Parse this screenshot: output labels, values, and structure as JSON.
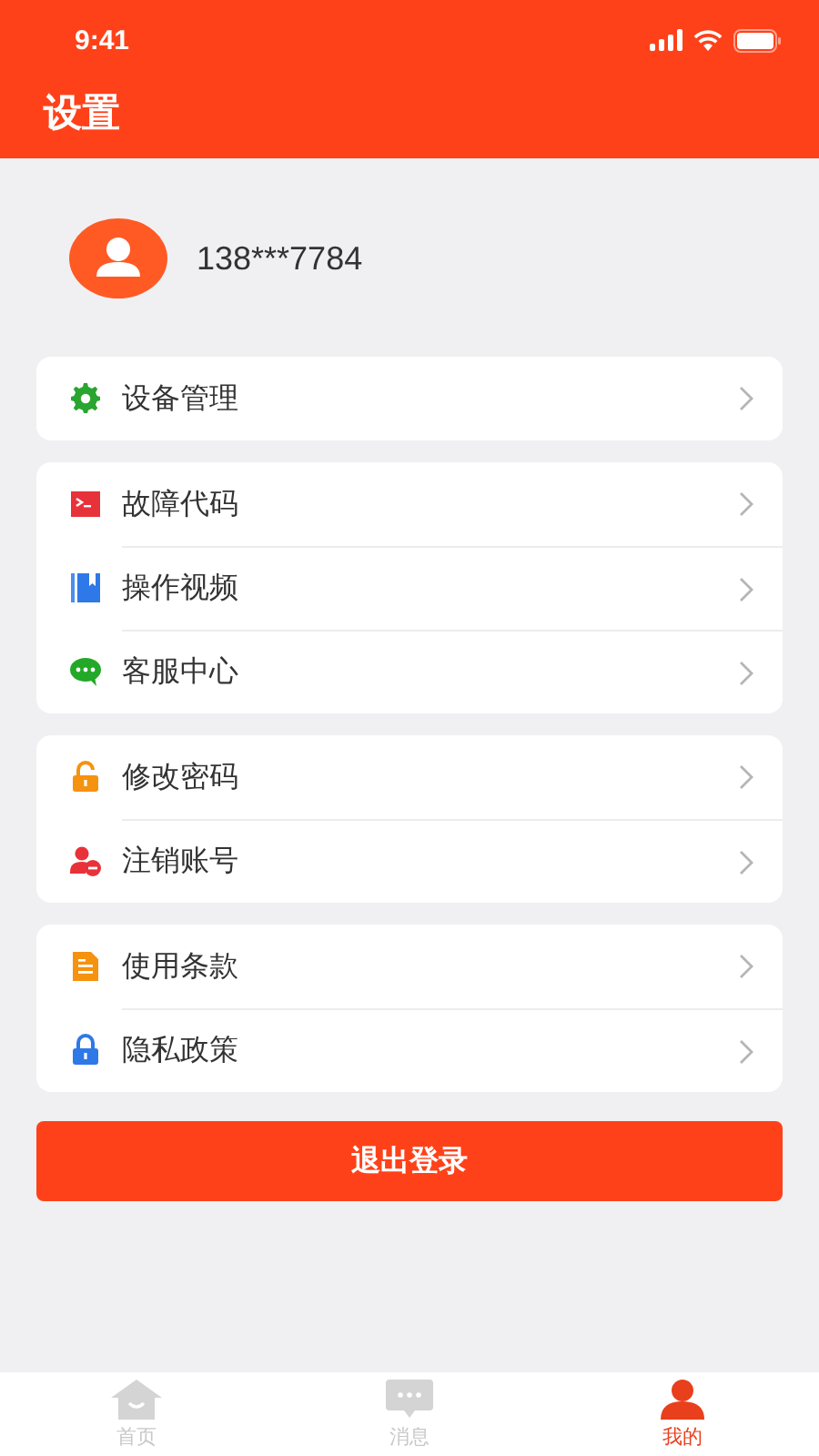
{
  "status_bar": {
    "time": "9:41"
  },
  "header": {
    "title": "设置"
  },
  "profile": {
    "phone": "138***7784"
  },
  "groups": [
    {
      "items": [
        {
          "label": "设备管理"
        }
      ]
    },
    {
      "items": [
        {
          "label": "故障代码"
        },
        {
          "label": "操作视频"
        },
        {
          "label": "客服中心"
        }
      ]
    },
    {
      "items": [
        {
          "label": "修改密码"
        },
        {
          "label": "注销账号"
        }
      ]
    },
    {
      "items": [
        {
          "label": "使用条款"
        },
        {
          "label": "隐私政策"
        }
      ]
    }
  ],
  "logout_button": "退出登录",
  "tab_bar": [
    {
      "label": "首页",
      "selected": false
    },
    {
      "label": "消息",
      "selected": false
    },
    {
      "label": "我的",
      "selected": true
    }
  ]
}
